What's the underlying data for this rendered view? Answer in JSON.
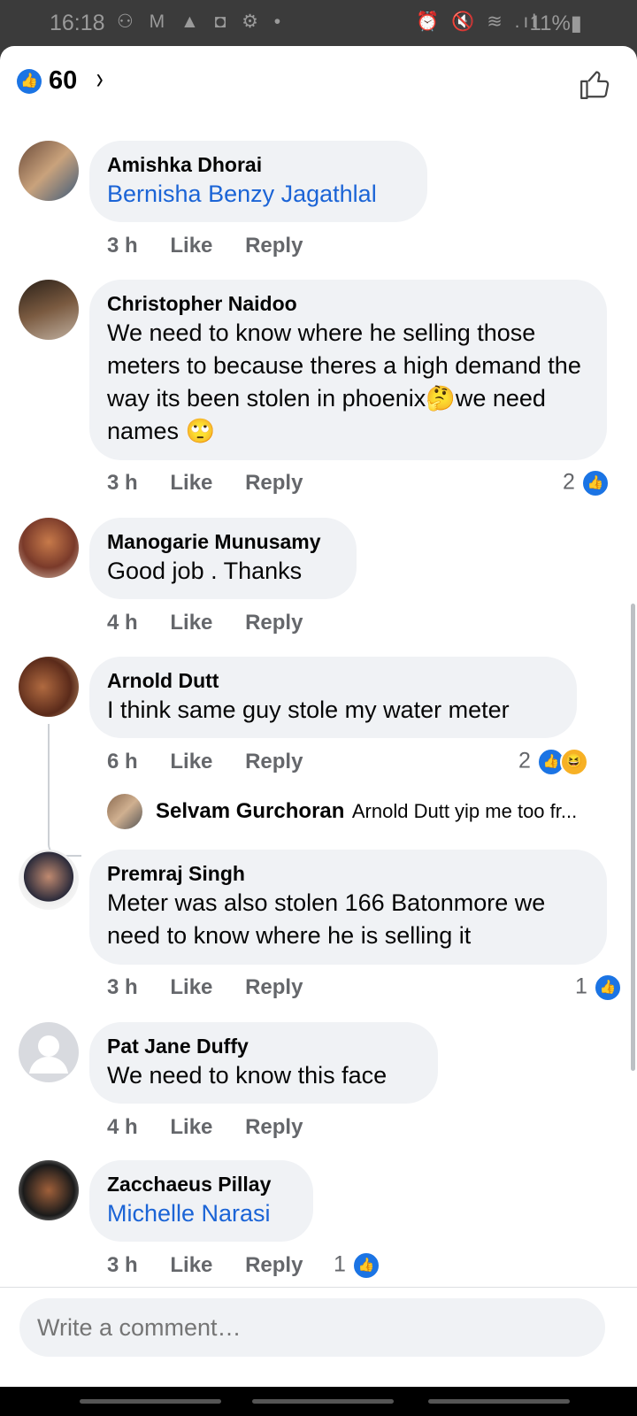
{
  "status_bar": {
    "time": "16:18",
    "left_icons": "⚇ M ▲ ◘ ⚙ •",
    "right_icons": "⏰ 🔇 ≋ .ıl",
    "battery": "11%▮"
  },
  "header": {
    "reaction_count": "60",
    "chevron": "›"
  },
  "comments": [
    {
      "author": "Amishka Dhorai",
      "text": "Bernisha Benzy Jagathlal",
      "time": "3 h",
      "like": "Like",
      "reply": "Reply"
    },
    {
      "author": "Christopher Naidoo",
      "text": "We need to know where he selling those meters to because theres a high demand the way its been stolen in phoenix🤔we need names 🙄",
      "time": "3 h",
      "like": "Like",
      "reply": "Reply",
      "reaction_count": "2"
    },
    {
      "author": "Manogarie Munusamy",
      "text": "Good job . Thanks",
      "time": "4 h",
      "like": "Like",
      "reply": "Reply"
    },
    {
      "author": "Arnold Dutt",
      "text": "I think same guy stole my water meter",
      "time": "6 h",
      "like": "Like",
      "reply": "Reply",
      "reaction_count": "2"
    },
    {
      "author": "Premraj Singh",
      "text": "Meter was also stolen 166 Batonmore we need to know where he is selling it",
      "time": "3 h",
      "like": "Like",
      "reply": "Reply",
      "reaction_count": "1"
    },
    {
      "author": "Pat Jane Duffy",
      "text": "We need to know this face",
      "time": "4 h",
      "like": "Like",
      "reply": "Reply"
    },
    {
      "author": "Zacchaeus Pillay",
      "text": "Michelle Narasi",
      "time": "3 h",
      "like": "Like",
      "reply": "Reply",
      "reaction_count": "1"
    }
  ],
  "reply_preview": {
    "author": "Selvam Gurchoran",
    "text": "Arnold Dutt yip me too fr..."
  },
  "composer": {
    "placeholder": "Write a comment…"
  },
  "colors": {
    "accent": "#1b74e4",
    "bubble": "#f0f2f5",
    "link": "#1b64d6"
  }
}
